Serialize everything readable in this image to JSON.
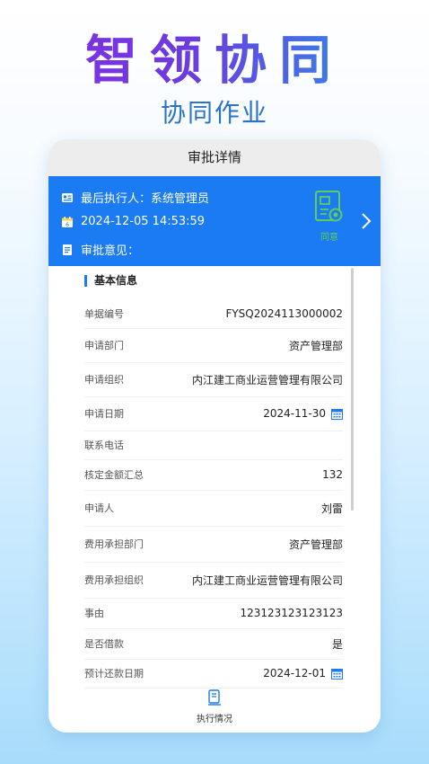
{
  "hero": {
    "title": "智领协同",
    "subtitle": "协同作业"
  },
  "card": {
    "header_title": "审批详情",
    "banner": {
      "executor": "最后执行人：系统管理员",
      "datetime": "2024-12-05 14:53:59",
      "opinion": "审批意见：",
      "status_label": "同意",
      "bg_color": "#1a7bf2",
      "status_color": "#5fcc5c"
    },
    "section_title": "基本信息",
    "fields": [
      {
        "label": "单据编号",
        "value": "FYSQ2024113000002"
      },
      {
        "label": "申请部门",
        "value": "资产管理部"
      },
      {
        "label": "申请组织",
        "value": "内江建工商业运营管理有限公司"
      },
      {
        "label": "申请日期",
        "value": "2024-11-30",
        "icon": "calendar-icon"
      },
      {
        "label": "联系电话",
        "value": ""
      },
      {
        "label": "核定金额汇总",
        "value": "132"
      },
      {
        "label": "申请人",
        "value": "刘雷"
      },
      {
        "label": "费用承担部门",
        "value": "资产管理部"
      },
      {
        "label": "费用承担组织",
        "value": "内江建工商业运营管理有限公司"
      },
      {
        "label": "事由",
        "value": "123123123123123"
      },
      {
        "label": "是否借款",
        "value": "是"
      },
      {
        "label": "预计还款日期",
        "value": "2024-12-01",
        "icon": "calendar-icon"
      }
    ],
    "bottom_tab_label": "执行情况"
  }
}
